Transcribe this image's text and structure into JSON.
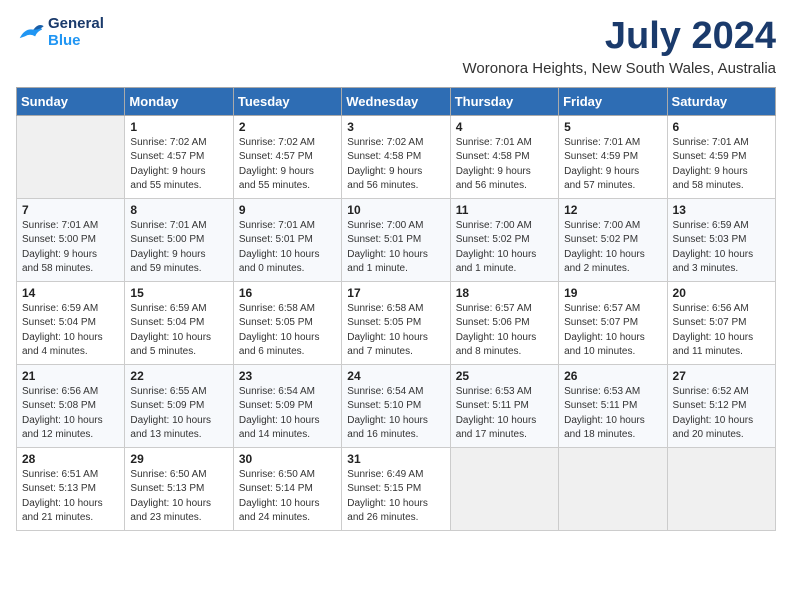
{
  "logo": {
    "line1": "General",
    "line2": "Blue"
  },
  "title": "July 2024",
  "location": "Woronora Heights, New South Wales, Australia",
  "days_of_week": [
    "Sunday",
    "Monday",
    "Tuesday",
    "Wednesday",
    "Thursday",
    "Friday",
    "Saturday"
  ],
  "weeks": [
    [
      {
        "day": "",
        "info": ""
      },
      {
        "day": "1",
        "info": "Sunrise: 7:02 AM\nSunset: 4:57 PM\nDaylight: 9 hours\nand 55 minutes."
      },
      {
        "day": "2",
        "info": "Sunrise: 7:02 AM\nSunset: 4:57 PM\nDaylight: 9 hours\nand 55 minutes."
      },
      {
        "day": "3",
        "info": "Sunrise: 7:02 AM\nSunset: 4:58 PM\nDaylight: 9 hours\nand 56 minutes."
      },
      {
        "day": "4",
        "info": "Sunrise: 7:01 AM\nSunset: 4:58 PM\nDaylight: 9 hours\nand 56 minutes."
      },
      {
        "day": "5",
        "info": "Sunrise: 7:01 AM\nSunset: 4:59 PM\nDaylight: 9 hours\nand 57 minutes."
      },
      {
        "day": "6",
        "info": "Sunrise: 7:01 AM\nSunset: 4:59 PM\nDaylight: 9 hours\nand 58 minutes."
      }
    ],
    [
      {
        "day": "7",
        "info": "Sunrise: 7:01 AM\nSunset: 5:00 PM\nDaylight: 9 hours\nand 58 minutes."
      },
      {
        "day": "8",
        "info": "Sunrise: 7:01 AM\nSunset: 5:00 PM\nDaylight: 9 hours\nand 59 minutes."
      },
      {
        "day": "9",
        "info": "Sunrise: 7:01 AM\nSunset: 5:01 PM\nDaylight: 10 hours\nand 0 minutes."
      },
      {
        "day": "10",
        "info": "Sunrise: 7:00 AM\nSunset: 5:01 PM\nDaylight: 10 hours\nand 1 minute."
      },
      {
        "day": "11",
        "info": "Sunrise: 7:00 AM\nSunset: 5:02 PM\nDaylight: 10 hours\nand 1 minute."
      },
      {
        "day": "12",
        "info": "Sunrise: 7:00 AM\nSunset: 5:02 PM\nDaylight: 10 hours\nand 2 minutes."
      },
      {
        "day": "13",
        "info": "Sunrise: 6:59 AM\nSunset: 5:03 PM\nDaylight: 10 hours\nand 3 minutes."
      }
    ],
    [
      {
        "day": "14",
        "info": "Sunrise: 6:59 AM\nSunset: 5:04 PM\nDaylight: 10 hours\nand 4 minutes."
      },
      {
        "day": "15",
        "info": "Sunrise: 6:59 AM\nSunset: 5:04 PM\nDaylight: 10 hours\nand 5 minutes."
      },
      {
        "day": "16",
        "info": "Sunrise: 6:58 AM\nSunset: 5:05 PM\nDaylight: 10 hours\nand 6 minutes."
      },
      {
        "day": "17",
        "info": "Sunrise: 6:58 AM\nSunset: 5:05 PM\nDaylight: 10 hours\nand 7 minutes."
      },
      {
        "day": "18",
        "info": "Sunrise: 6:57 AM\nSunset: 5:06 PM\nDaylight: 10 hours\nand 8 minutes."
      },
      {
        "day": "19",
        "info": "Sunrise: 6:57 AM\nSunset: 5:07 PM\nDaylight: 10 hours\nand 10 minutes."
      },
      {
        "day": "20",
        "info": "Sunrise: 6:56 AM\nSunset: 5:07 PM\nDaylight: 10 hours\nand 11 minutes."
      }
    ],
    [
      {
        "day": "21",
        "info": "Sunrise: 6:56 AM\nSunset: 5:08 PM\nDaylight: 10 hours\nand 12 minutes."
      },
      {
        "day": "22",
        "info": "Sunrise: 6:55 AM\nSunset: 5:09 PM\nDaylight: 10 hours\nand 13 minutes."
      },
      {
        "day": "23",
        "info": "Sunrise: 6:54 AM\nSunset: 5:09 PM\nDaylight: 10 hours\nand 14 minutes."
      },
      {
        "day": "24",
        "info": "Sunrise: 6:54 AM\nSunset: 5:10 PM\nDaylight: 10 hours\nand 16 minutes."
      },
      {
        "day": "25",
        "info": "Sunrise: 6:53 AM\nSunset: 5:11 PM\nDaylight: 10 hours\nand 17 minutes."
      },
      {
        "day": "26",
        "info": "Sunrise: 6:53 AM\nSunset: 5:11 PM\nDaylight: 10 hours\nand 18 minutes."
      },
      {
        "day": "27",
        "info": "Sunrise: 6:52 AM\nSunset: 5:12 PM\nDaylight: 10 hours\nand 20 minutes."
      }
    ],
    [
      {
        "day": "28",
        "info": "Sunrise: 6:51 AM\nSunset: 5:13 PM\nDaylight: 10 hours\nand 21 minutes."
      },
      {
        "day": "29",
        "info": "Sunrise: 6:50 AM\nSunset: 5:13 PM\nDaylight: 10 hours\nand 23 minutes."
      },
      {
        "day": "30",
        "info": "Sunrise: 6:50 AM\nSunset: 5:14 PM\nDaylight: 10 hours\nand 24 minutes."
      },
      {
        "day": "31",
        "info": "Sunrise: 6:49 AM\nSunset: 5:15 PM\nDaylight: 10 hours\nand 26 minutes."
      },
      {
        "day": "",
        "info": ""
      },
      {
        "day": "",
        "info": ""
      },
      {
        "day": "",
        "info": ""
      }
    ]
  ]
}
